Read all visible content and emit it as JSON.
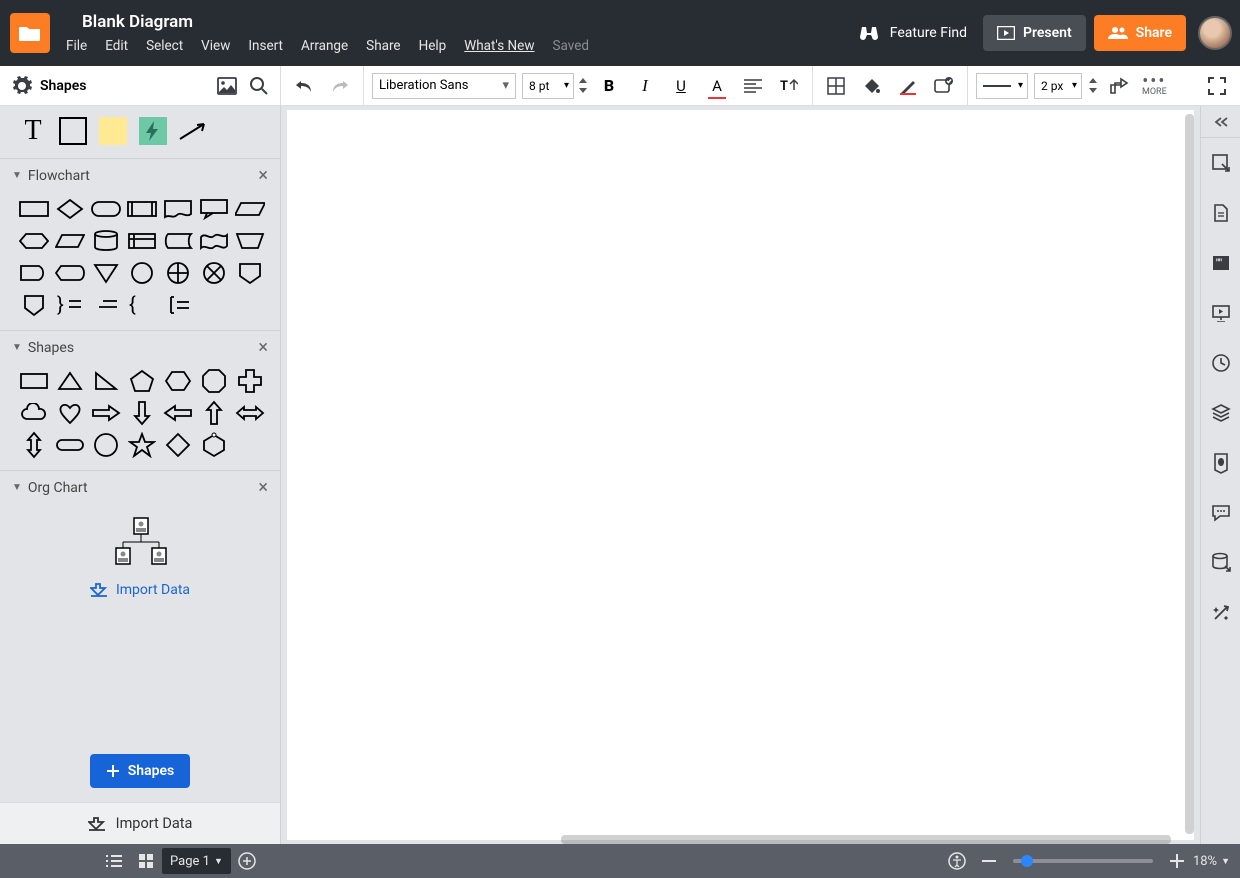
{
  "header": {
    "title": "Blank Diagram",
    "menu": [
      "File",
      "Edit",
      "Select",
      "View",
      "Insert",
      "Arrange",
      "Share",
      "Help"
    ],
    "whats_new": "What's New",
    "saved": "Saved",
    "feature_find": "Feature Find",
    "present": "Present",
    "share": "Share"
  },
  "toolbar": {
    "font": "Liberation Sans",
    "size": "8 pt",
    "line_width": "2 px",
    "more": "MORE"
  },
  "sidebar": {
    "title": "Shapes",
    "sections": {
      "flowchart": "Flowchart",
      "shapes": "Shapes",
      "orgchart": "Org Chart"
    },
    "import_data_link": "Import Data",
    "add_shapes": "Shapes",
    "import_data_bar": "Import Data"
  },
  "footer": {
    "page": "Page 1",
    "zoom": "18%"
  }
}
